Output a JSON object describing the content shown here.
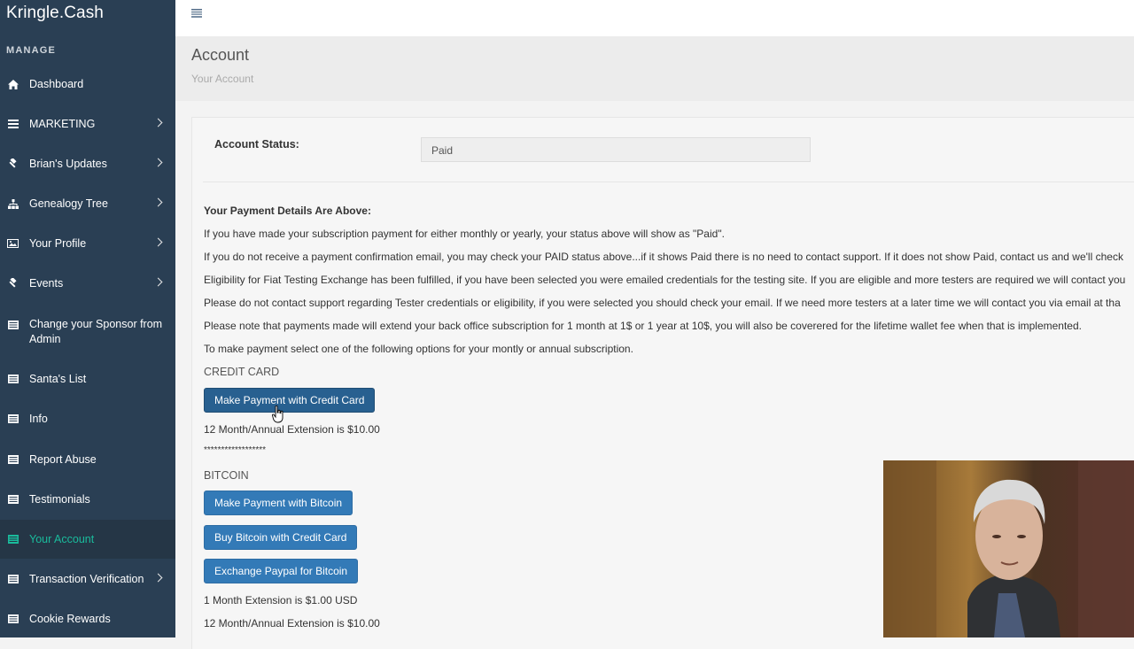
{
  "app": {
    "brand": "Kringle.Cash"
  },
  "sidebar": {
    "section_title": "MANAGE",
    "items": [
      {
        "label": "Dashboard",
        "icon": "home-icon"
      },
      {
        "label": "MARKETING",
        "icon": "bars-icon"
      },
      {
        "label": "Brian's Updates",
        "icon": "gavel-icon"
      },
      {
        "label": "Genealogy Tree",
        "icon": "sitemap-icon"
      },
      {
        "label": "Your Profile",
        "icon": "image-icon"
      },
      {
        "label": "Events",
        "icon": "gavel-icon"
      },
      {
        "label": "Change your Sponsor from Admin",
        "icon": "list-icon"
      },
      {
        "label": "Santa's List",
        "icon": "list-icon"
      },
      {
        "label": "Info",
        "icon": "list-icon"
      },
      {
        "label": "Report Abuse",
        "icon": "list-icon"
      },
      {
        "label": "Testimonials",
        "icon": "list-icon"
      },
      {
        "label": "Your Account",
        "icon": "list-icon",
        "active": true
      },
      {
        "label": "Transaction Verification",
        "icon": "list-icon"
      },
      {
        "label": "Cookie Rewards",
        "icon": "list-icon"
      }
    ]
  },
  "header": {
    "title": "Account",
    "subtitle": "Your Account"
  },
  "account": {
    "status_label": "Account Status:",
    "status_value": "Paid"
  },
  "content": {
    "heading": "Your Payment Details Are Above:",
    "lines": [
      "If you have made your subscription payment for either monthly or yearly, your status above will show as \"Paid\".",
      "If you do not receive a payment confirmation email, you may check your PAID status above...if it shows Paid there is no need to contact support. If it does not show Paid, contact us and we'll check",
      "Eligibility for Fiat Testing Exchange has been fulfilled, if you have been selected you were emailed credentials for the testing site. If you are eligible and more testers are required we will contact you",
      "Please do not contact support regarding Tester credentials or eligibility, if you were selected you should check your email. If we need more testers at a later time we will contact you via email at tha",
      "Please note that payments made will extend your back office subscription for 1 month at 1$ or 1 year at 10$, you will also be coverered for the lifetime wallet fee when that is implemented.",
      "To make payment select one of the following options for your montly or annual subscription."
    ],
    "credit_card_label": "CREDIT CARD",
    "credit_card_button": "Make Payment with Credit Card",
    "credit_card_note": "12 Month/Annual Extension is $10.00",
    "separator": "******************",
    "bitcoin_label": "BITCOIN",
    "bitcoin_buttons": [
      "Make Payment with Bitcoin",
      "Buy Bitcoin with Credit Card",
      "Exchange Paypal for Bitcoin"
    ],
    "bitcoin_notes": [
      "1 Month Extension is $1.00 USD",
      "12 Month/Annual Extension is $10.00"
    ]
  },
  "colors": {
    "sidebar_bg": "#2a3f54",
    "active_text": "#1abb9c",
    "button": "#337ab7"
  }
}
